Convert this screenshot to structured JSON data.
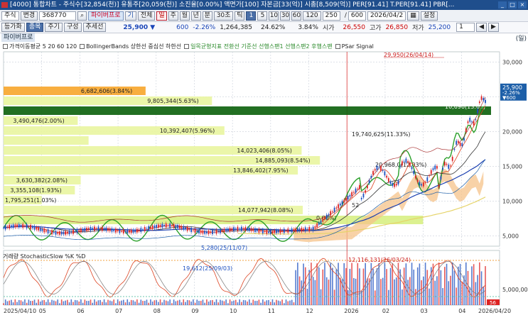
{
  "window": {
    "title": "[4000] 통합차트 - 주식수[32,854(천)] 유통주[20,059(천)] 소진율[0.00%] 액면가[100] 자본금[33(억)] 시총[8,509(억)] PER[91.41] T.PER[91.41] PBR[..."
  },
  "toolbar": {
    "market": "주식",
    "change": "변경",
    "code": "368770",
    "name": "파이버프로",
    "gi": "기",
    "full": "전체",
    "min_sel": "일",
    "tabs": [
      "주",
      "월",
      "년",
      "분",
      "30초",
      "틱"
    ],
    "intervals": [
      "1",
      "5",
      "10",
      "30",
      "60",
      "120"
    ],
    "count": "250",
    "total": "600",
    "date": "2026/04/2",
    "settings": "설정"
  },
  "quote": {
    "price": "25,900 ▼",
    "change": "600",
    "pct": "-2.26%",
    "volume": "1,264,385",
    "turnover": "24.62%",
    "r2": "3.84%",
    "open_label": "시가",
    "open": "26,550",
    "high_label": "고가",
    "high": "26,850",
    "low_label": "저가",
    "low": "25,200",
    "page": "1"
  },
  "row2": {
    "left1": "등가화",
    "left2": "종목",
    "left3": "주기",
    "left4": "구성",
    "left5": "추세선"
  },
  "panel": {
    "title": "파이버프로",
    "tag": "(일)"
  },
  "legend": [
    {
      "text": "가격이동평균 5 20 60 120",
      "color": "#333"
    },
    {
      "text": "BollingerBands 상한선 중심선 하한선",
      "color": "#333"
    },
    {
      "text": "일목균형지표 전환선 기준선 선행스팬1 선행스팬2 후행스팬",
      "color": "#333"
    },
    {
      "text": "PSar Signal",
      "color": "#333"
    }
  ],
  "sublegend": "거래량 StochasticSlow %K %D",
  "chart_data": {
    "type": "candlestick-with-volume-profile",
    "price_axis": [
      "30,000",
      "25,000",
      "20,000",
      "15,000",
      "10,000",
      "5,000"
    ],
    "price_labels": {
      "current": "25,900",
      "pct": "-2.26%",
      "chg": "▼600"
    },
    "x_ticks": [
      "2025/04/10",
      "05",
      "06",
      "07",
      "08",
      "09",
      "10",
      "11",
      "12",
      "2026",
      "02",
      "03",
      "04",
      "2026/04/20"
    ],
    "annotations": [
      "29,950(26/04/14)",
      "5,280(25/11/07)",
      "12,116,131(26/03/24)",
      "19,612(25/09/03)",
      "52"
    ],
    "volume_profile": [
      "6,682,606(3.84%)",
      "9,805,344(5.63%)",
      "3,490,476(2.00%)",
      "10,392,407(5.96%)",
      "14,023,406(8.05%)",
      "14,885,093(8.54%)",
      "13,846,402(7.95%)",
      "3,630,382(2.08%)",
      "3,355,108(1.93%)",
      "1,795,251(1.03%)",
      "14,077,942(8.08%)",
      "19,740,625(11.33%)",
      "20,968,0(12.03%)",
      "10,696(13.65)",
      "0.00%)"
    ],
    "sub_axis": [
      "5,000,000"
    ],
    "sub_extra": "56"
  }
}
